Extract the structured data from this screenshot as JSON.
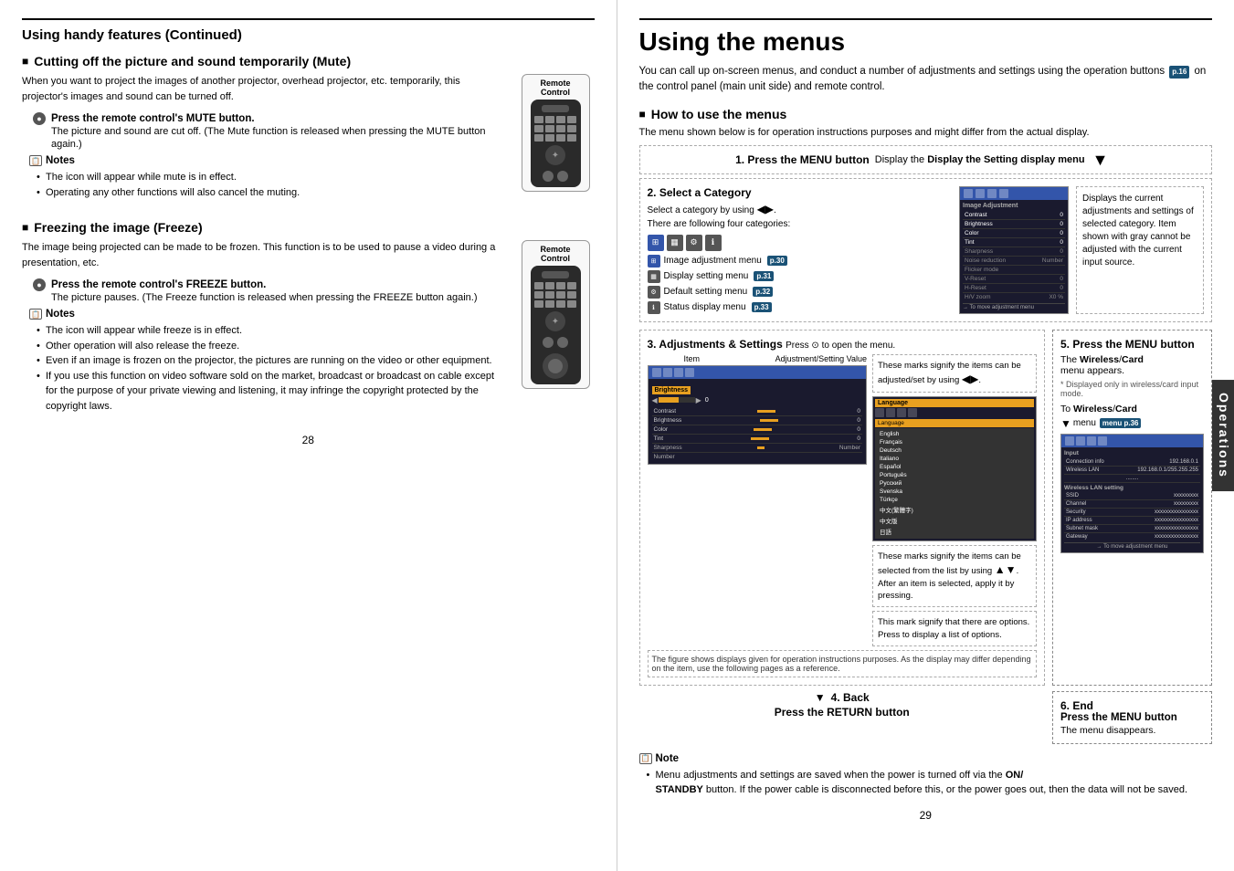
{
  "left_page": {
    "title": "Using handy features (Continued)",
    "sections": [
      {
        "id": "mute",
        "heading": "Cutting off the picture and sound temporarily (Mute)",
        "intro": "When you want to project the images of another projector, overhead projector, etc. temporarily, this projector's images and sound can be turned off.",
        "remote_label": "Remote Control",
        "press_label": "Press the remote control's MUTE button.",
        "press_detail": "The picture and sound are cut off. (The Mute function is released when pressing the MUTE button again.)",
        "notes_header": "Notes",
        "notes": [
          "The  icon will appear while mute is in effect.",
          "Operating any other functions will also cancel the muting."
        ]
      },
      {
        "id": "freeze",
        "heading": "Freezing the image (Freeze)",
        "intro": "The image being projected can be made to be frozen. This function is to be used to pause a video during a presentation, etc.",
        "remote_label": "Remote Control",
        "press_label": "Press the remote control's FREEZE button.",
        "press_detail": "The picture pauses. (The Freeze function is released when pressing the FREEZE button again.)",
        "notes_header": "Notes",
        "notes": [
          "The  icon will appear while freeze is in effect.",
          "Other operation will also release the freeze.",
          "Even if an image is frozen on the projector, the pictures are running on the video or other equipment.",
          "If you use this function on video software sold on the market, broadcast or broadcast on cable except for the purpose of your private viewing and listening, it may infringe the copyright protected by the copyright laws."
        ]
      }
    ],
    "page_number": "28"
  },
  "right_page": {
    "title": "Using the menus",
    "intro": "You can call up on-screen menus, and conduct a number of adjustments and settings using the operation buttons",
    "intro_ref": "p.16",
    "intro_end": "on the control panel (main unit side) and remote control.",
    "how_to_title": "How to use the menus",
    "how_to_intro": "The menu shown below is for operation instructions purposes and might differ from the actual display.",
    "steps": {
      "step1": {
        "label": "1. Press the MENU button",
        "description": "Display the Setting display menu"
      },
      "step2": {
        "label": "2. Select a Category",
        "select_text": "Select a category by using",
        "categories_text": "There are following four categories:",
        "menus": [
          {
            "icon": "image-adj",
            "label": "Image adjustment menu",
            "ref": "p.30"
          },
          {
            "icon": "display-set",
            "label": "Display setting menu",
            "ref": "p.31"
          },
          {
            "icon": "default-set",
            "label": "Default setting menu",
            "ref": "p.32"
          },
          {
            "icon": "status",
            "label": "Status display menu",
            "ref": "p.33"
          }
        ],
        "right_text": "Displays the current adjustments and settings of selected category. Item shown with gray cannot be adjusted with the current input source."
      },
      "step3": {
        "label": "3. Adjustments & Settings",
        "description": "Press  to open the menu.",
        "item_label": "Item",
        "value_label": "Adjustment/Setting Value",
        "callout1": "These marks signify the items can be adjusted/set by using",
        "callout2": "These marks signify the items can be selected from the list by using",
        "callout2b": "After an item is selected, apply it by pressing.",
        "callout3": "This mark signify that there are options. Press  to display a list of options.",
        "footer_text": "The figure shows displays given for operation instructions purposes. As the display may differ depending on the item, use the following pages as a reference."
      },
      "step4": {
        "label": "4. Back",
        "description": "Press the RETURN button"
      },
      "step5": {
        "label": "5. Press the MENU button",
        "detail": "The Wireless/Card menu appears.",
        "asterisk": "* Displayed only in wireless/card input mode.",
        "wireless_label": "To Wireless/Card",
        "wireless_ref": "menu p.36"
      },
      "step6": {
        "label": "6. End",
        "description": "Press the MENU button",
        "detail": "The menu disappears."
      }
    },
    "note": {
      "header": "Note",
      "items": [
        "Menu adjustments and settings are saved when the power is turned off via the ON/STANDBY button. If the power cable is disconnected before this, or the power goes out, then the data will not be saved."
      ]
    },
    "page_number": "29",
    "operations_label": "Operations"
  }
}
